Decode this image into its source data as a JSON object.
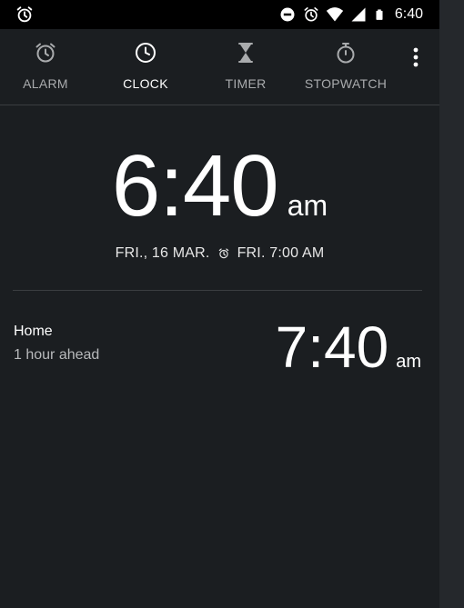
{
  "status_bar": {
    "time": "6:40",
    "left_icon": "alarm-clock-icon",
    "right_icons": [
      "do-not-disturb-icon",
      "alarm-clock-icon",
      "wifi-icon",
      "cell-signal-icon",
      "battery-icon"
    ]
  },
  "tabs": [
    {
      "label": "ALARM",
      "icon": "alarm-clock-icon",
      "active": false
    },
    {
      "label": "CLOCK",
      "icon": "clock-icon",
      "active": true
    },
    {
      "label": "TIMER",
      "icon": "hourglass-icon",
      "active": false
    },
    {
      "label": "STOPWATCH",
      "icon": "stopwatch-icon",
      "active": false
    }
  ],
  "overflow_menu_icon": "more-vertical-icon",
  "main_clock": {
    "time": "6:40",
    "ampm": "am",
    "date": "FRI., 16 MAR.",
    "next_alarm": "FRI. 7:00 AM"
  },
  "world_clocks": [
    {
      "city": "Home",
      "offset": "1 hour ahead",
      "time": "7:40",
      "ampm": "am"
    }
  ],
  "colors": {
    "background": "#1b1e21",
    "status_bar": "#000000",
    "active_tab": "#ffffff",
    "inactive_tab": "#a9abad",
    "divider": "#3a3d41"
  }
}
